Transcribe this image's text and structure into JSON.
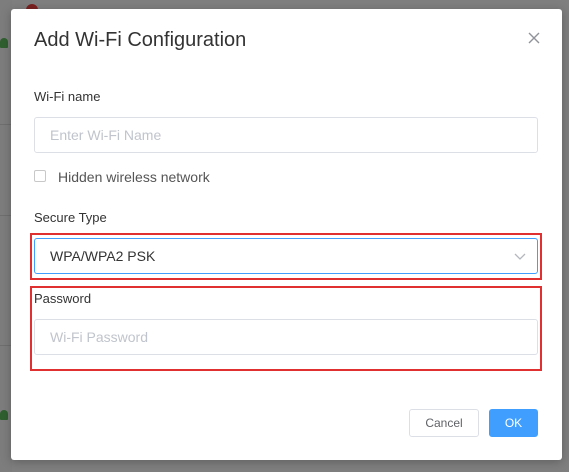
{
  "dialog": {
    "title": "Add Wi-Fi Configuration",
    "wifi_name": {
      "label": "Wi-Fi name",
      "placeholder": "Enter Wi-Fi Name",
      "value": ""
    },
    "hidden_network": {
      "label": "Hidden wireless network",
      "checked": false
    },
    "secure_type": {
      "label": "Secure Type",
      "selected": "WPA/WPA2 PSK"
    },
    "password": {
      "label": "Password",
      "placeholder": "Wi-Fi Password",
      "value": ""
    },
    "buttons": {
      "cancel": "Cancel",
      "ok": "OK"
    }
  },
  "colors": {
    "primary": "#409eff",
    "highlight": "#e03030",
    "overlay": "#7f7f7f"
  }
}
